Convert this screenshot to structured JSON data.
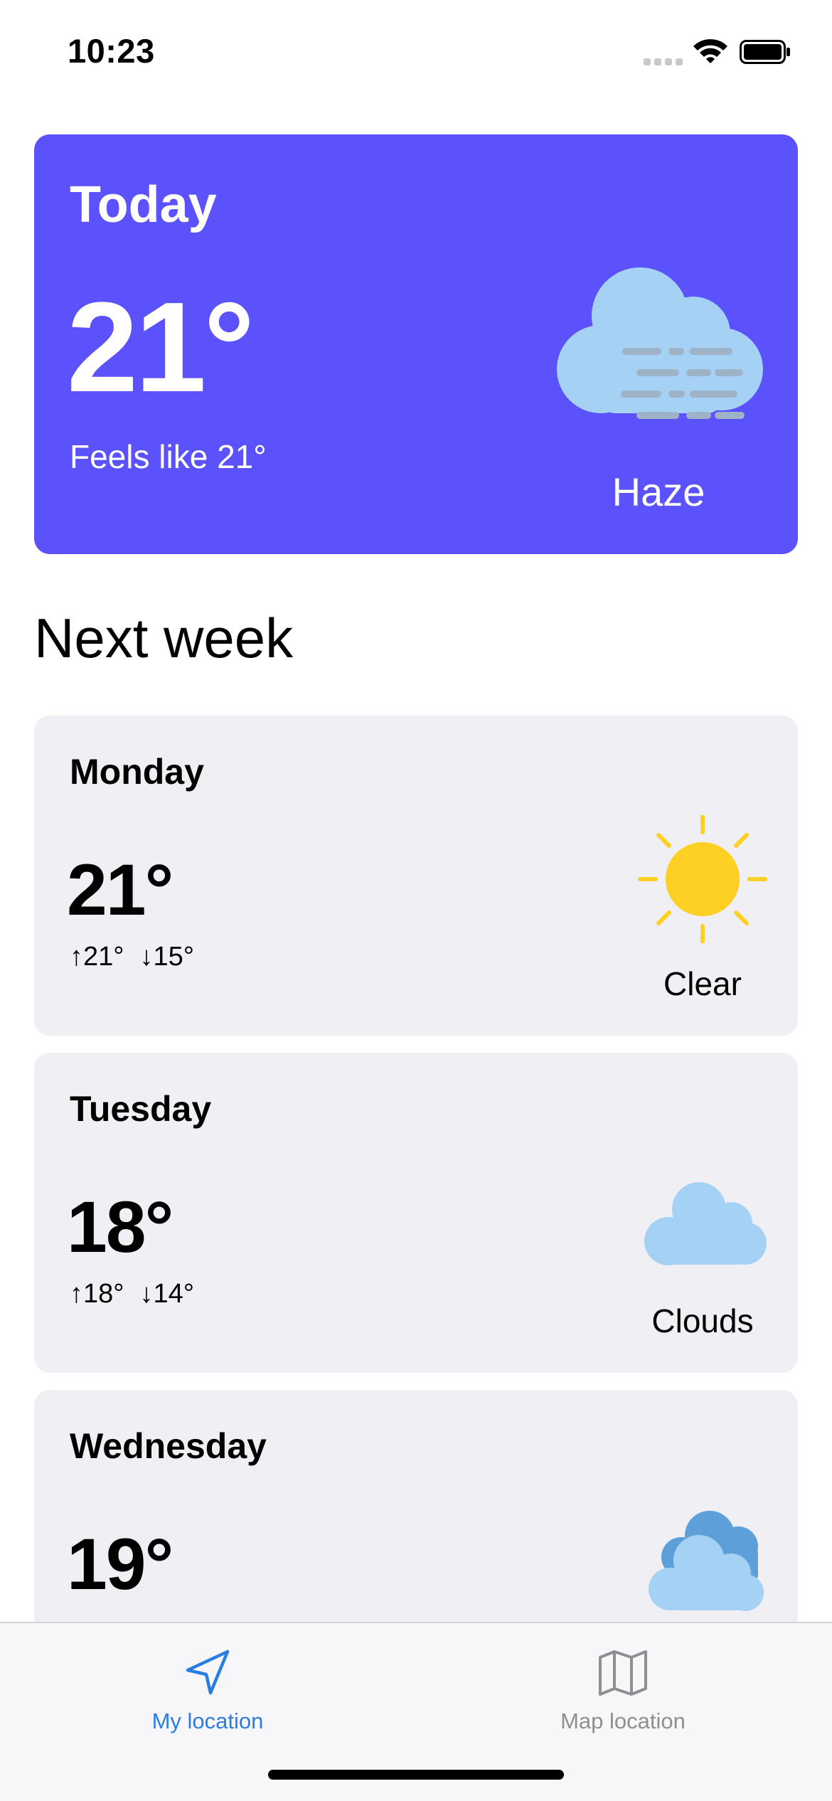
{
  "status_bar": {
    "time": "10:23"
  },
  "today": {
    "title": "Today",
    "temperature": "21°",
    "feels_like": "Feels like 21°",
    "condition": "Haze",
    "icon": "haze-icon",
    "card_color": "#5b52fb"
  },
  "section_title": "Next week",
  "forecast": [
    {
      "day": "Monday",
      "temperature": "21°",
      "high": "↑21°",
      "low": "↓15°",
      "condition": "Clear",
      "icon": "sun-icon"
    },
    {
      "day": "Tuesday",
      "temperature": "18°",
      "high": "↑18°",
      "low": "↓14°",
      "condition": "Clouds",
      "icon": "cloud-icon"
    },
    {
      "day": "Wednesday",
      "temperature": "19°",
      "icon": "clouds-icon"
    }
  ],
  "tabs": [
    {
      "label": "My location",
      "icon": "navigation-arrow-icon",
      "active": true
    },
    {
      "label": "Map location",
      "icon": "map-icon",
      "active": false
    }
  ],
  "colors": {
    "accent": "#2a7de1",
    "card_bg": "#efeff4",
    "sun": "#fdd023",
    "cloud": "#a5d1f5"
  }
}
